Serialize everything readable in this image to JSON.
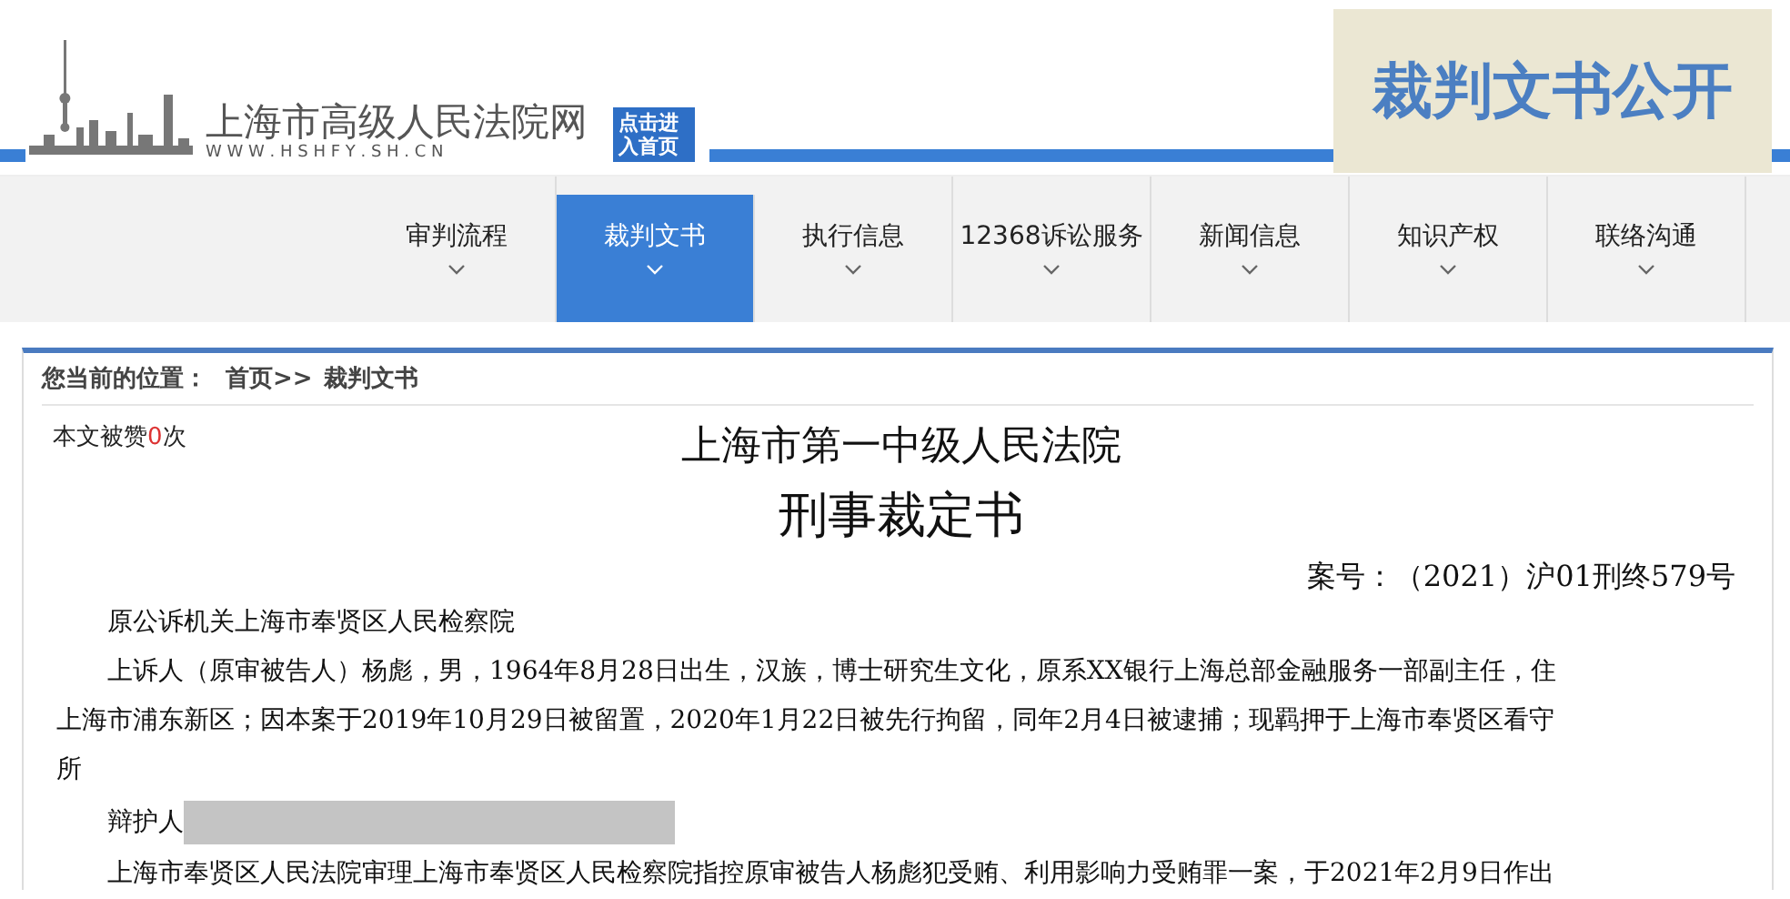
{
  "header": {
    "site_name": "上海市高级人民法院网",
    "site_url": "W W W . H S H F Y . S H . C N",
    "home_link": "点击进入首页",
    "banner": "裁判文书公开"
  },
  "nav": [
    {
      "label": "审判流程",
      "selected": false
    },
    {
      "label": "裁判文书",
      "selected": true
    },
    {
      "label": "执行信息",
      "selected": false
    },
    {
      "label": "12368诉讼服务",
      "selected": false
    },
    {
      "label": "新闻信息",
      "selected": false
    },
    {
      "label": "知识产权",
      "selected": false
    },
    {
      "label": "联络沟通",
      "selected": false
    }
  ],
  "breadcrumb": {
    "label": "您当前的位置：",
    "items": [
      "首页>>",
      "裁判文书"
    ]
  },
  "likes": {
    "before": "本文被赞",
    "count": "0",
    "after": "次"
  },
  "document": {
    "court": "上海市第一中级人民法院",
    "title": "刑事裁定书",
    "case_number": "案号：（2021）沪01刑终579号",
    "paragraphs": [
      {
        "kind": "text",
        "text": "原公诉机关上海市奉贤区人民检察院"
      },
      {
        "kind": "text",
        "text": "上诉人（原审被告人）杨彪，男，1964年8月28日出生，汉族，博士研究生文化，原系XX银行上海总部金融服务一部副主任，住上海市浦东新区；因本案于2019年10月29日被留置，2020年1月22日被先行拘留，同年2月4日被逮捕；现羁押于上海市奉贤区看守所"
      },
      {
        "kind": "redacted",
        "text": "辩护人"
      },
      {
        "kind": "text",
        "text": "上海市奉贤区人民法院审理上海市奉贤区人民检察院指控原审被告人杨彪犯受贿、利用影响力受贿罪一案，于2021年2月9日作出"
      }
    ]
  }
}
